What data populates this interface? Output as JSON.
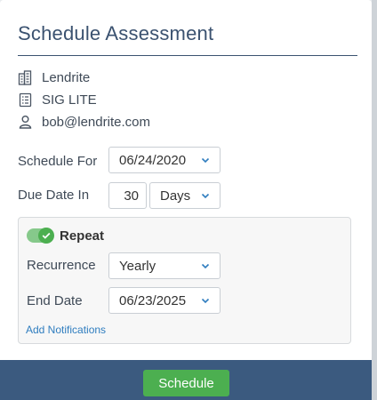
{
  "modal": {
    "title": "Schedule Assessment"
  },
  "info": {
    "company": {
      "text": "Lendrite",
      "icon": "building-icon"
    },
    "template": {
      "text": "SIG LITE",
      "icon": "document-list-icon"
    },
    "contact": {
      "text": "bob@lendrite.com",
      "icon": "user-icon"
    }
  },
  "form": {
    "schedule_for": {
      "label": "Schedule For",
      "value": "06/24/2020"
    },
    "due_date_in": {
      "label": "Due Date In",
      "number": "30",
      "unit": "Days"
    },
    "repeat": {
      "toggle_on": true,
      "label": "Repeat",
      "recurrence": {
        "label": "Recurrence",
        "value": "Yearly"
      },
      "end_date": {
        "label": "End Date",
        "value": "06/23/2025"
      },
      "add_notifications": "Add Notifications"
    }
  },
  "footer": {
    "schedule_label": "Schedule"
  },
  "colors": {
    "title": "#3b5270",
    "footer_bg": "#3b5a7f",
    "primary_button": "#4caf50",
    "link": "#2f7dbf",
    "toggle_on": "#4caf50"
  }
}
